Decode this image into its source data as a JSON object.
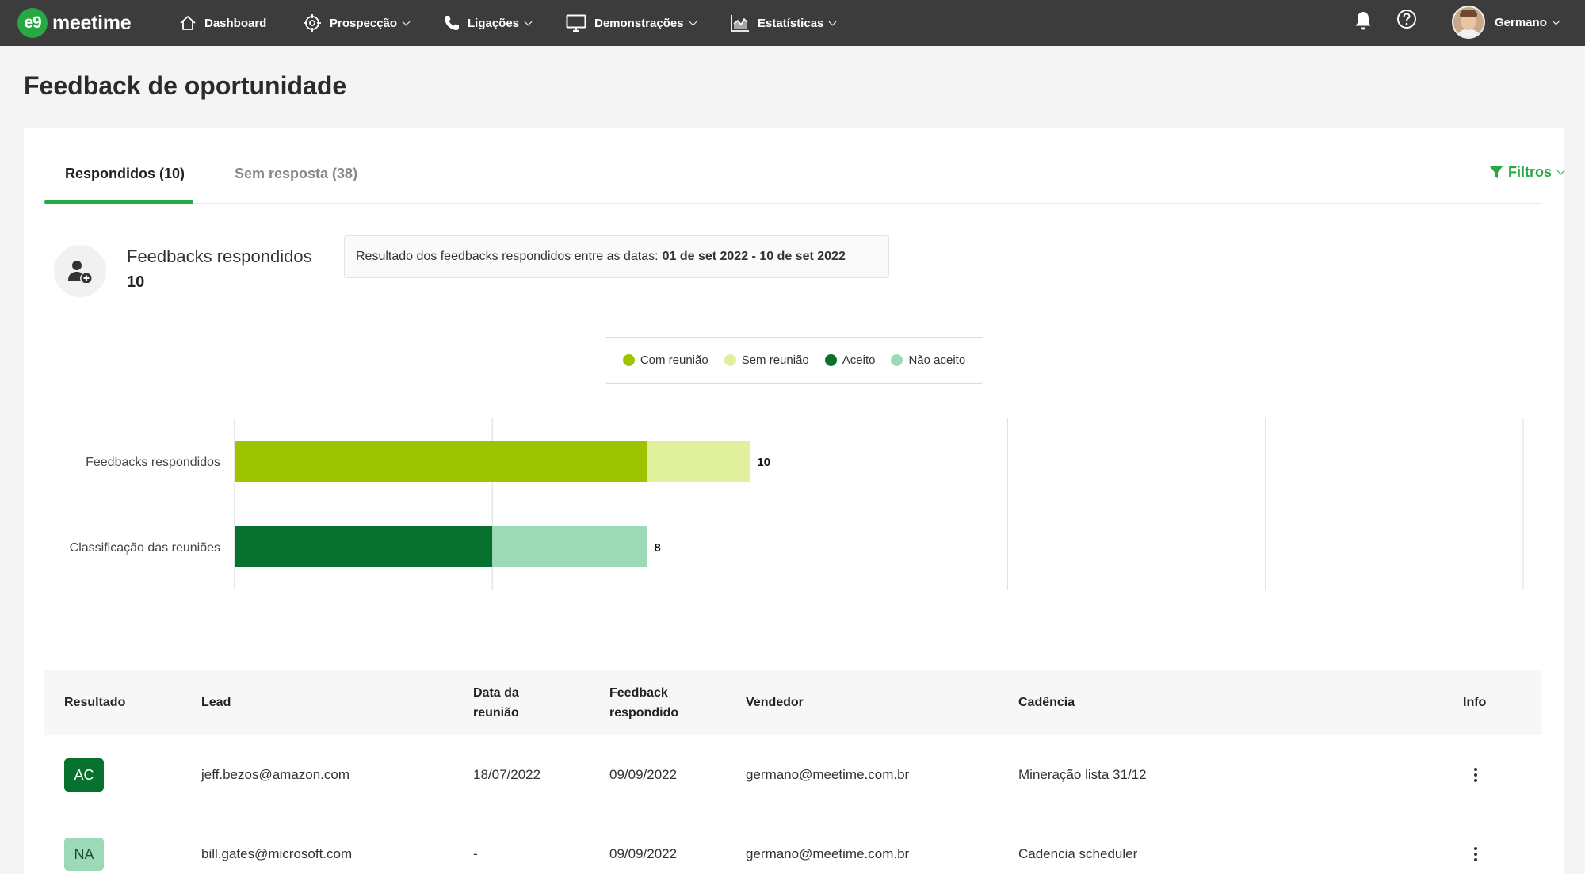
{
  "app": {
    "logo_mark": "e9",
    "logo_text": "meetime"
  },
  "nav": {
    "items": [
      {
        "label": "Dashboard",
        "icon": "home-icon"
      },
      {
        "label": "Prospecção",
        "icon": "target-icon"
      },
      {
        "label": "Ligações",
        "icon": "phone-icon"
      },
      {
        "label": "Demonstrações",
        "icon": "monitor-icon"
      },
      {
        "label": "Estatísticas",
        "icon": "chart-icon"
      }
    ],
    "user_name": "Germano"
  },
  "page": {
    "title": "Feedback de oportunidade"
  },
  "tabs": {
    "active": "Respondidos (10)",
    "inactive": "Sem resposta (38)",
    "filters_label": "Filtros"
  },
  "summary": {
    "title": "Feedbacks respondidos",
    "value": "10",
    "date_prefix": "Resultado dos feedbacks respondidos entre as datas:",
    "date_range": "01 de set 2022 - 10 de set 2022"
  },
  "chart_data": {
    "type": "bar",
    "orientation": "horizontal",
    "stacked": true,
    "categories": [
      "Feedbacks respondidos",
      "Classificação das reuniões"
    ],
    "series": [
      {
        "name": "Com reunião",
        "color": "#9ec400",
        "values": [
          8,
          0
        ]
      },
      {
        "name": "Sem reunião",
        "color": "#e1f09c",
        "values": [
          2,
          0
        ]
      },
      {
        "name": "Aceito",
        "color": "#06722e",
        "values": [
          0,
          5
        ]
      },
      {
        "name": "Não aceito",
        "color": "#9cdab7",
        "values": [
          0,
          3
        ]
      }
    ],
    "totals": [
      "10",
      "8"
    ],
    "xlim": [
      0,
      25
    ],
    "xticks": [
      0,
      5,
      10,
      15,
      20,
      25
    ],
    "xtick_labels": [
      "0",
      "5",
      "10",
      "15",
      "20",
      "25"
    ],
    "grid": "vertical",
    "legend_position": "top"
  },
  "table": {
    "headers": {
      "resultado": "Resultado",
      "lead": "Lead",
      "data_line1": "Data da",
      "data_line2": "reunião",
      "feedback_line1": "Feedback",
      "feedback_line2": "respondido",
      "vendedor": "Vendedor",
      "cadencia": "Cadência",
      "info": "Info"
    },
    "rows": [
      {
        "badge": "AC",
        "lead": "jeff.bezos@amazon.com",
        "data": "18/07/2022",
        "feedback": "09/09/2022",
        "vendedor": "germano@meetime.com.br",
        "cadencia": "Mineração lista 31/12"
      },
      {
        "badge": "NA",
        "lead": "bill.gates@microsoft.com",
        "data": "-",
        "feedback": "09/09/2022",
        "vendedor": "germano@meetime.com.br",
        "cadencia": "Cadencia scheduler"
      }
    ]
  }
}
